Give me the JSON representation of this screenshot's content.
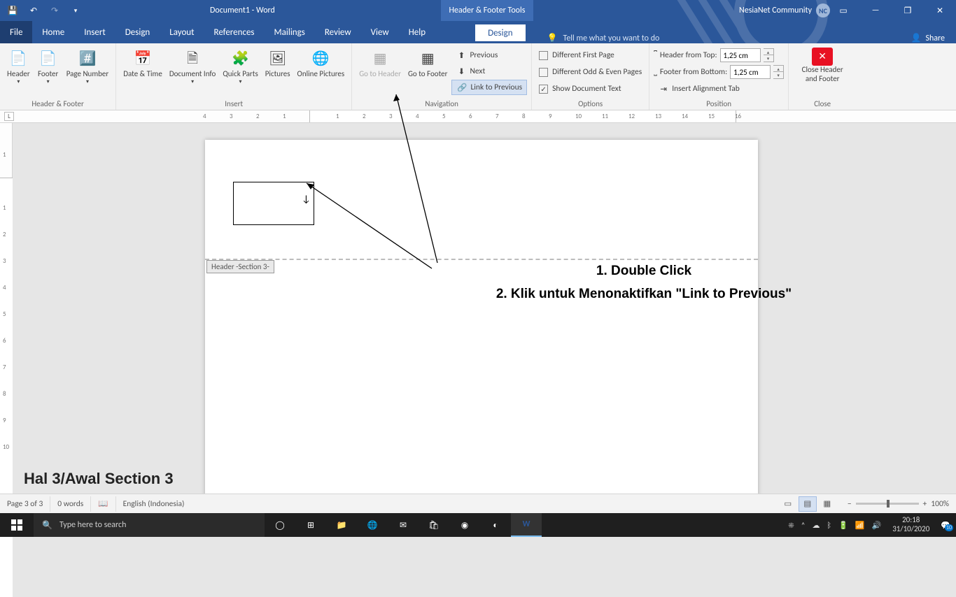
{
  "titlebar": {
    "doc_title": "Document1 - Word",
    "context_title": "Header & Footer Tools",
    "user_name": "NesiaNet Community",
    "user_initials": "NC"
  },
  "menu": {
    "file": "File",
    "home": "Home",
    "insert": "Insert",
    "design_main": "Design",
    "layout": "Layout",
    "references": "References",
    "mailings": "Mailings",
    "review": "Review",
    "view": "View",
    "help": "Help",
    "design_ctx": "Design",
    "tellme": "Tell me what you want to do",
    "share": "Share"
  },
  "ribbon": {
    "hf": {
      "header": "Header",
      "footer": "Footer",
      "page_number": "Page Number",
      "group": "Header & Footer"
    },
    "insert": {
      "datetime": "Date & Time",
      "docinfo": "Document Info",
      "quickparts": "Quick Parts",
      "pictures": "Pictures",
      "online_pictures": "Online Pictures",
      "group": "Insert"
    },
    "nav": {
      "goto_header": "Go to Header",
      "goto_footer": "Go to Footer",
      "previous": "Previous",
      "next": "Next",
      "link_prev": "Link to Previous",
      "group": "Navigation"
    },
    "options": {
      "diff_first": "Different First Page",
      "diff_oddeven": "Different Odd & Even Pages",
      "show_doc": "Show Document Text",
      "group": "Options"
    },
    "position": {
      "header_from_top": "Header from Top:",
      "footer_from_bottom": "Footer from Bottom:",
      "insert_align_tab": "Insert Alignment Tab",
      "val": "1,25 cm",
      "group": "Position"
    },
    "close": {
      "label": "Close Header and Footer",
      "group": "Close"
    }
  },
  "page": {
    "header_tag": "Header -Section 3-"
  },
  "annotations": {
    "line1": "1. Double Click",
    "line2": "2. Klik untuk Menonaktifkan \"Link to Previous\"",
    "overlay": "Hal 3/Awal Section 3"
  },
  "status": {
    "page": "Page 3 of 3",
    "words": "0 words",
    "lang": "English (Indonesia)",
    "zoom": "100%"
  },
  "taskbar": {
    "search_placeholder": "Type here to search",
    "time": "20:18",
    "date": "31/10/2020",
    "notif_count": "10"
  }
}
